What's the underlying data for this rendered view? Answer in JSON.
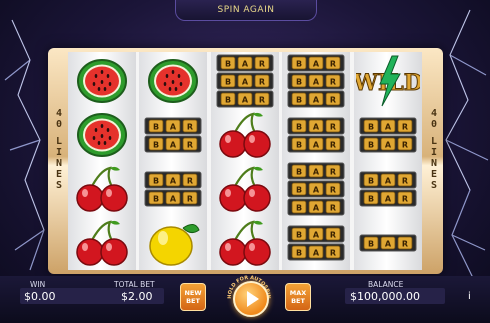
{
  "banner": {
    "text": "SPIN AGAIN"
  },
  "lines_label": {
    "left": [
      "4",
      "0",
      "L",
      "I",
      "N",
      "E",
      "S"
    ],
    "right": [
      "4",
      "0",
      "L",
      "I",
      "N",
      "E",
      "S"
    ]
  },
  "reels": [
    [
      "watermelon",
      "watermelon",
      "cherries",
      "cherries"
    ],
    [
      "watermelon",
      "bar",
      "bar",
      "lemon"
    ],
    [
      "bar",
      "cherries",
      "cherries",
      "cherries"
    ],
    [
      "bar",
      "bar",
      "bar",
      "bar"
    ],
    [
      "wild",
      "bar",
      "bar",
      "bar"
    ]
  ],
  "symbol_text": {
    "bar": "BAR",
    "wild": "WILD"
  },
  "panel": {
    "win_label": "WIN",
    "win_value": "$0.00",
    "total_bet_label": "TOTAL BET",
    "total_bet_value": "$2.00",
    "new_bet_label": "NEW BET",
    "spin_arc_text": "HOLD FOR AUTOSPIN",
    "max_bet_label": "MAX BET",
    "balance_label": "BALANCE",
    "balance_value": "$100,000.00",
    "info_label": "i"
  },
  "colors": {
    "bar_gold": "#e0a733",
    "cherry_red": "#d2161f",
    "melon_green": "#2e9c2c",
    "wild_green": "#21b35a",
    "lemon_yellow": "#f4d500",
    "button_orange": "#e67b1f"
  }
}
